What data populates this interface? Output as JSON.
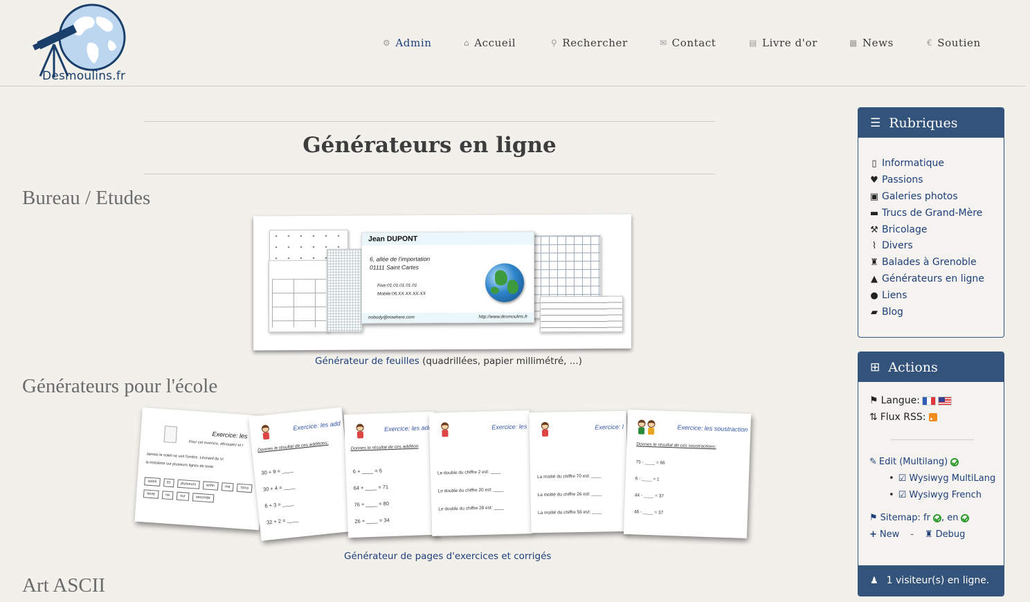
{
  "site": {
    "logo_text": "Desmoulins.fr"
  },
  "nav": [
    {
      "icon": "gears-icon",
      "label": "Admin"
    },
    {
      "icon": "home-icon",
      "label": "Accueil"
    },
    {
      "icon": "search-icon",
      "label": "Rechercher"
    },
    {
      "icon": "envelope-icon",
      "label": "Contact"
    },
    {
      "icon": "book-icon",
      "label": "Livre d'or"
    },
    {
      "icon": "calendar-icon",
      "label": "News"
    },
    {
      "icon": "euro-icon",
      "label": "Soutien"
    }
  ],
  "main": {
    "title": "Générateurs en ligne",
    "sections": [
      {
        "heading": "Bureau / Etudes",
        "link": "Générateur de feuilles",
        "caption_rest": " (quadrillées, papier millimétré, ...)"
      },
      {
        "heading": "Générateurs pour l'école",
        "link": "Générateur de pages d'exercices et corrigés"
      },
      {
        "heading": "Art ASCII"
      }
    ],
    "card": {
      "name": "Jean DUPONT",
      "address_1": "6, allée de l'importation",
      "address_2": "01111 Saint Cartes",
      "fixe": "Fixe:01.01.01.01.01",
      "mobile": "Mobile:06.XX.XX.XX.XX",
      "email": "nobody@nowhere.com",
      "url": "http://www.desmoulins.fr"
    },
    "exercises": [
      {
        "header": "Exercice: les",
        "subtitle": "Pour cet exercice, découpez et r",
        "lines": [
          "Jamais le soleil ne voit l'ombre. Léonard de Vi",
          "la troisième sur plusieurs lignes de texte."
        ],
        "words": [
          "soleil",
          "Et",
          "plusieurs",
          "enfin",
          "me",
          "Vinci",
          "texte",
          "ne",
          "sur",
          "seconde"
        ]
      },
      {
        "header": "Exercice: les add",
        "subtitle": "Donnes le résultat de ces additions:",
        "lines": [
          "30 + 9 = ____",
          "30 + 4 = ____",
          "6 + 3 = ____",
          "32 + 2 = ____"
        ]
      },
      {
        "header": "Exercice: les add",
        "subtitle": "Donnes le résultat de ces addition",
        "lines": [
          "6 + ____ = 6",
          "64 + ____ = 71",
          "76 + ____ = 80",
          "26 + ____ = 34"
        ]
      },
      {
        "header": "Exercice: les",
        "subtitle": "",
        "lines": [
          "Le double du chiffre 2 est: ____",
          "Le double du chiffre 20 est: ____",
          "Le double du chiffre 28 est: ____"
        ]
      },
      {
        "header": "Exercice: l",
        "subtitle": "",
        "lines": [
          "La moitié du chiffre 70 est: ____",
          "La moitié du chiffre 26 est: ____",
          "La moitié du chiffre 56 est: ____"
        ]
      },
      {
        "header": "Exercice: les soustraction",
        "subtitle": "Donnes le résultat de ces soustractions:",
        "lines": [
          "75 - ____ = 66",
          "6 - ____ = 1",
          "44 - ____ = 37",
          "46 - ____ = 37"
        ]
      }
    ]
  },
  "sidebar": {
    "rubriques": {
      "title": "Rubriques",
      "items": [
        {
          "icon": "mobile-icon",
          "label": "Informatique"
        },
        {
          "icon": "heart-icon",
          "label": "Passions"
        },
        {
          "icon": "picture-icon",
          "label": "Galeries photos"
        },
        {
          "icon": "comment-icon",
          "label": "Trucs de Grand-Mère"
        },
        {
          "icon": "wrench-icon",
          "label": "Bricolage"
        },
        {
          "icon": "paperclip-icon",
          "label": "Divers"
        },
        {
          "icon": "rook-icon",
          "label": "Balades à Grenoble"
        },
        {
          "icon": "road-icon",
          "label": "Générateurs en ligne"
        },
        {
          "icon": "globe-icon",
          "label": "Liens"
        },
        {
          "icon": "briefcase-icon",
          "label": "Blog"
        }
      ]
    },
    "actions": {
      "title": "Actions",
      "langue": "Langue:",
      "rss": "Flux RSS:",
      "edit": "Edit (Multilang)",
      "wysiwyg_multi": "Wysiwyg MultiLang",
      "wysiwyg_fr": "Wysiwyg French",
      "sitemap": "Sitemap: fr",
      "sitemap_en": ", en",
      "new": "New",
      "sep": "-",
      "debug": "Debug",
      "visitors": "1 visiteur(s) en ligne."
    }
  }
}
